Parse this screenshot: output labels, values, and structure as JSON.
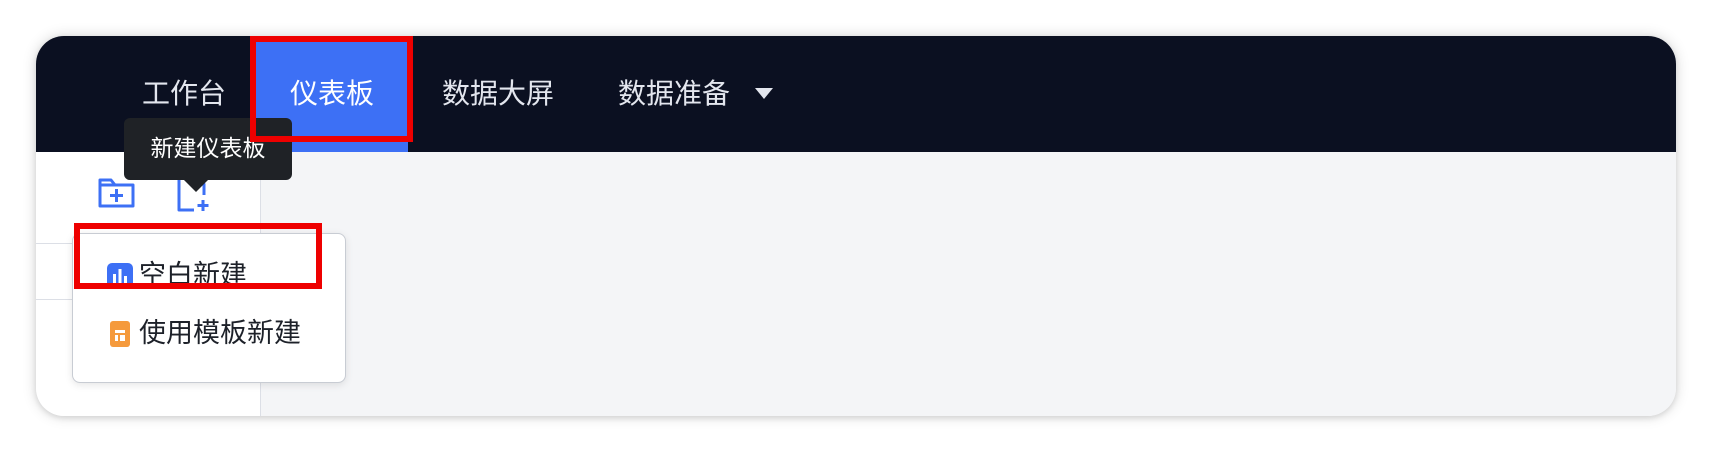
{
  "nav": {
    "items": [
      {
        "label": "工作台"
      },
      {
        "label": "仪表板"
      },
      {
        "label": "数据大屏"
      },
      {
        "label": "数据准备"
      }
    ],
    "active_index": 1
  },
  "tooltip": {
    "text": "新建仪表板"
  },
  "toolbar": {
    "new_folder_icon": "folder-plus-icon",
    "new_dashboard_icon": "file-plus-icon"
  },
  "menu": {
    "items": [
      {
        "label": "空白新建",
        "icon": "bar-chart-icon",
        "icon_color": "#3d70f5"
      },
      {
        "label": "使用模板新建",
        "icon": "template-icon",
        "icon_color": "#f59a3c"
      }
    ]
  },
  "colors": {
    "navbar_bg": "#0b1021",
    "accent": "#3d70f5",
    "highlight": "#ee0000",
    "template_orange": "#f59a3c"
  }
}
